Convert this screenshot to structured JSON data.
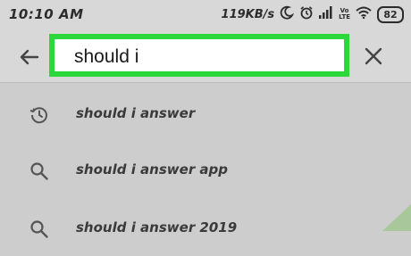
{
  "status_bar": {
    "time": "10:10 AM",
    "net_speed": "119KB/s",
    "volte_top": "Vo",
    "volte_bottom": "LTE",
    "battery": "82",
    "icons": [
      "moon-icon",
      "alarm-icon",
      "signal-icon",
      "volte-icon",
      "wifi-icon",
      "battery-icon"
    ]
  },
  "search": {
    "query": "should i",
    "highlight_color": "#2ad83a",
    "back_icon": "back-arrow-icon",
    "clear_icon": "close-icon"
  },
  "suggestions": [
    {
      "icon": "history-icon",
      "text": "should i answer"
    },
    {
      "icon": "search-icon",
      "text": "should i answer app"
    },
    {
      "icon": "search-icon",
      "text": "should i answer 2019"
    }
  ]
}
